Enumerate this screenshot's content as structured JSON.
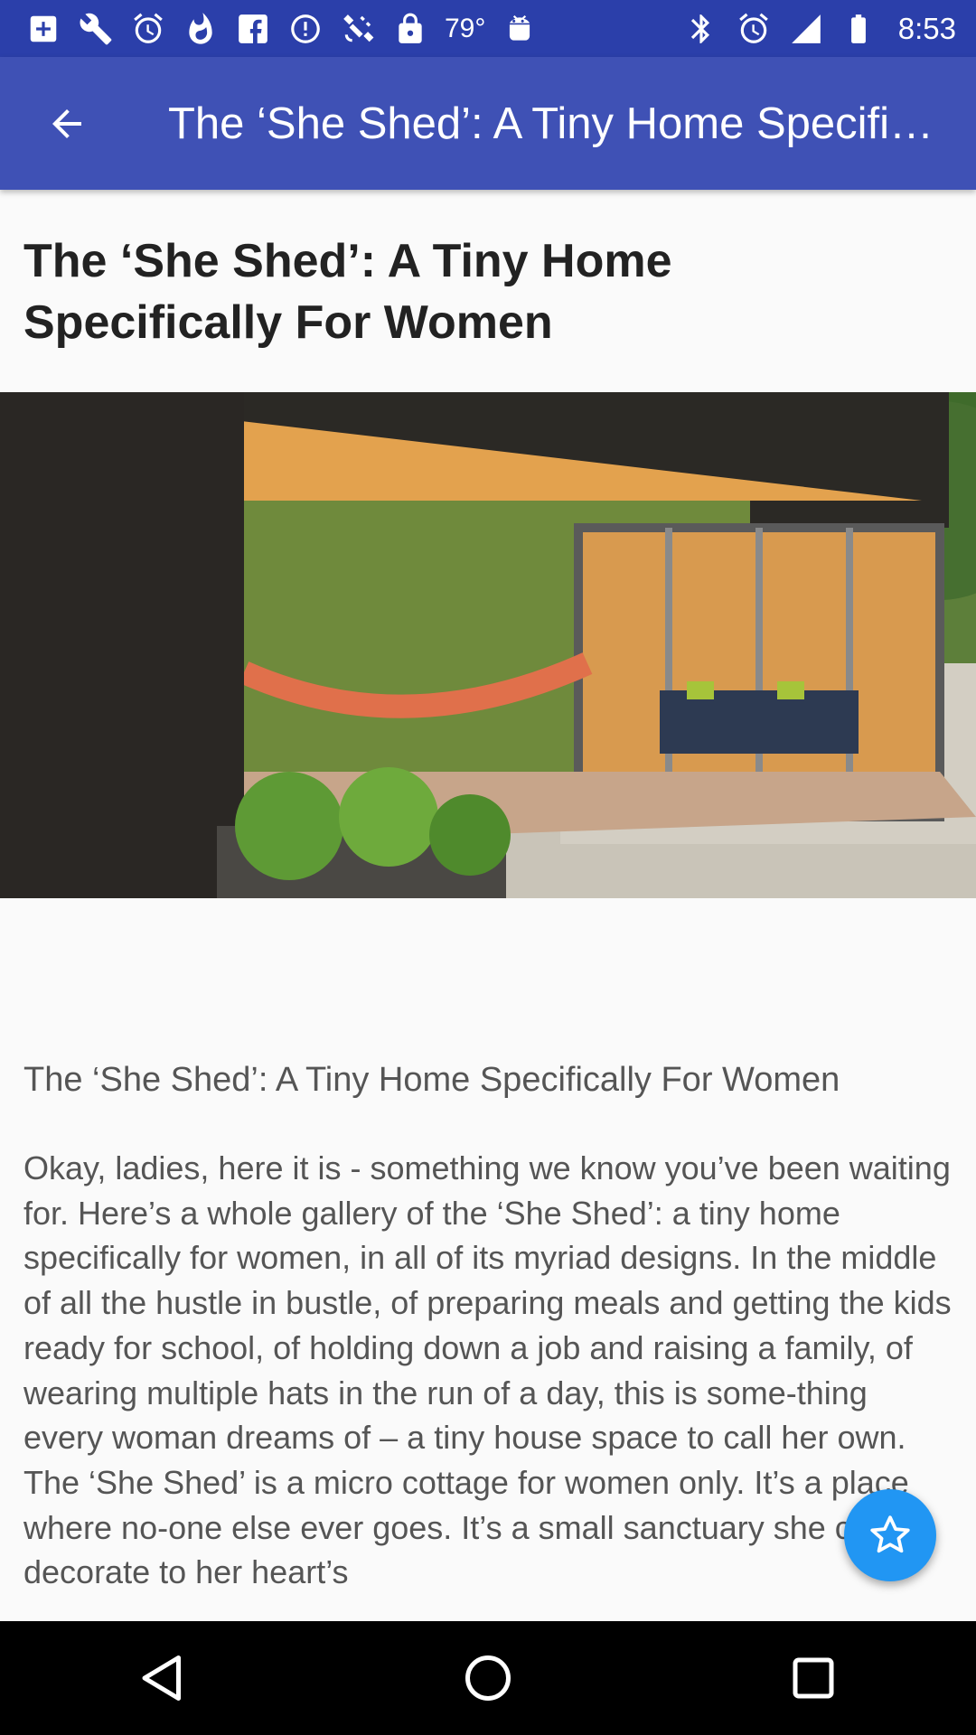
{
  "status_bar": {
    "temperature": "79°",
    "time": "8:53",
    "icons": [
      "medical-plus-icon",
      "wrench-icon",
      "alarm-icon",
      "flame-icon",
      "facebook-icon",
      "info-icon",
      "satellite-icon",
      "lock-icon",
      "android-icon",
      "bluetooth-icon",
      "alarm-clock-icon",
      "signal-icon",
      "battery-icon"
    ]
  },
  "app_bar": {
    "title": "The ‘She Shed’: A Tiny Home Specifically For Women",
    "back_icon": "arrow-back-icon",
    "background": "#3f51b5"
  },
  "article": {
    "heading": "The ‘She Shed’: A Tiny Home Specifically For Women",
    "image": "she-shed-photo",
    "subtitle": "The ‘She Shed’: A Tiny Home Specifically For Women",
    "body": "Okay, ladies, here it is - something we know you’ve been waiting for. Here’s a whole gallery of the ‘She Shed’: a tiny home specifically for women, in all of its myriad designs. In the middle of all the hustle in bustle, of preparing meals and getting the kids ready for school, of holding down a job and raising a family, of wearing multiple hats in the run of a day, this is some-thing every woman dreams of – a tiny house space to call her own.  The ‘She Shed’ is a micro cottage for women only. It’s a place where no-one else ever goes. It’s a small sanctuary she can decorate to her heart’s"
  },
  "fab": {
    "icon": "star-icon",
    "color": "#2196f3"
  },
  "nav_bar": {
    "icons": [
      "back-triangle-icon",
      "home-circle-icon",
      "recents-square-icon"
    ]
  }
}
